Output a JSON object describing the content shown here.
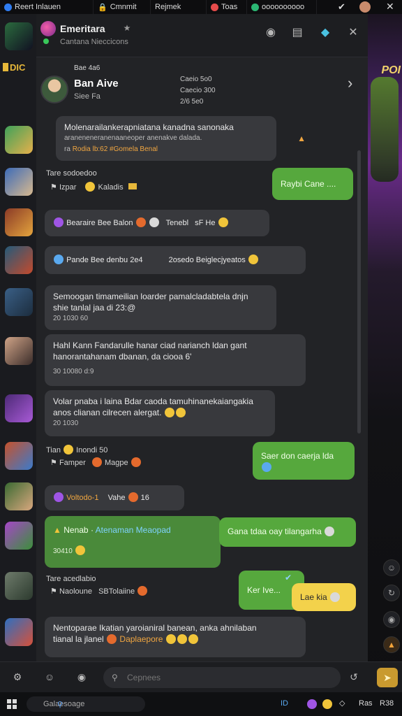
{
  "topbar": {
    "items": [
      {
        "label": "Reert Inlauen",
        "color": "#2f7cf0"
      },
      {
        "label": "Cmnmit",
        "color": "#888888"
      },
      {
        "label": "Rejmek",
        "color": "#888888"
      },
      {
        "label": "Toas",
        "color": "#e54b4b"
      },
      {
        "label": "oooooooooo",
        "color": "#2bb673"
      }
    ]
  },
  "rail": {
    "tag": "DIC"
  },
  "art": {
    "text": "POI"
  },
  "header": {
    "title": "Emeritara",
    "subtitle": "Cantana Nieccicons"
  },
  "profile": {
    "small": "Bae 4a6",
    "name": "Ban Aive",
    "status": "Siee Fa",
    "meta": [
      "Caeio 5o0",
      "Caecio 300",
      "2/6 5e0"
    ]
  },
  "messages": {
    "m1": {
      "line1": "Molenarailankerapniatana kanadna sanonaka",
      "line2": "araneneneranenaaneoper anenakve dalada.",
      "line3a": "ra",
      "line3b": "Rodia lb:62 #Gomela Benal"
    },
    "m2": {
      "label": "Tare sodoedoo",
      "line": "Izpar",
      "extra": "Kaladis"
    },
    "m3": {
      "text": "Raybi Cane ...."
    },
    "m4": {
      "a": "Bearaire Bee Balon",
      "b": "Tenebl",
      "c": "sF He"
    },
    "m5": {
      "a": "Pande Bee denbu 2e4",
      "b": "2osedo Beiglecjyeatos"
    },
    "m6": {
      "line1": "Semoogan timameilian loarder pamalcladabtela dnjn",
      "line2": "shie tanlal jaa di 23:@",
      "time": "20 1030 60"
    },
    "m7": {
      "line1": "Hahl Kann Fandarulle hanar ciad narianch ldan gant",
      "line2": "hanorantahanam dbanan, da ciooa 6'",
      "time": "30 10080 d:9"
    },
    "m8": {
      "line1": "Volar pnaba i laina Bdar caoda tamuhinanekaiangakia",
      "line2": "anos clianan cilrecen alergat.",
      "time": "20 1030"
    },
    "m9": {
      "text": "Saer don caerja lda"
    },
    "m10": {
      "label": "Tian",
      "label2": "Inondi 50",
      "line": "Famper",
      "extra": "Magpe"
    },
    "m11": {
      "a": "Voltodo-1",
      "b": "Vahe",
      "c": "16"
    },
    "m12": {
      "a": "Nenab",
      "b": "Atenaman Meaopad",
      "time": "30410"
    },
    "m13": {
      "text": "Gana tdaa oay tilangarha"
    },
    "m14": {
      "label": "Tare acedlabio",
      "line": "Naoloune",
      "extra": "SBTolaiine"
    },
    "m15": {
      "text": "Ker Ive..."
    },
    "m16": {
      "text": "Lae kia"
    },
    "m17": {
      "line1": "Nentoparae Ikatian yaroianiral banean, anka ahnilaban",
      "line2": "tianal la jlanel",
      "orange": "Daplaepore"
    }
  },
  "input": {
    "placeholder": "Cepnees"
  },
  "taskbar": {
    "search_label": "Galaesoage",
    "right1": "ID",
    "right2": "Ras",
    "right3": "R38"
  }
}
